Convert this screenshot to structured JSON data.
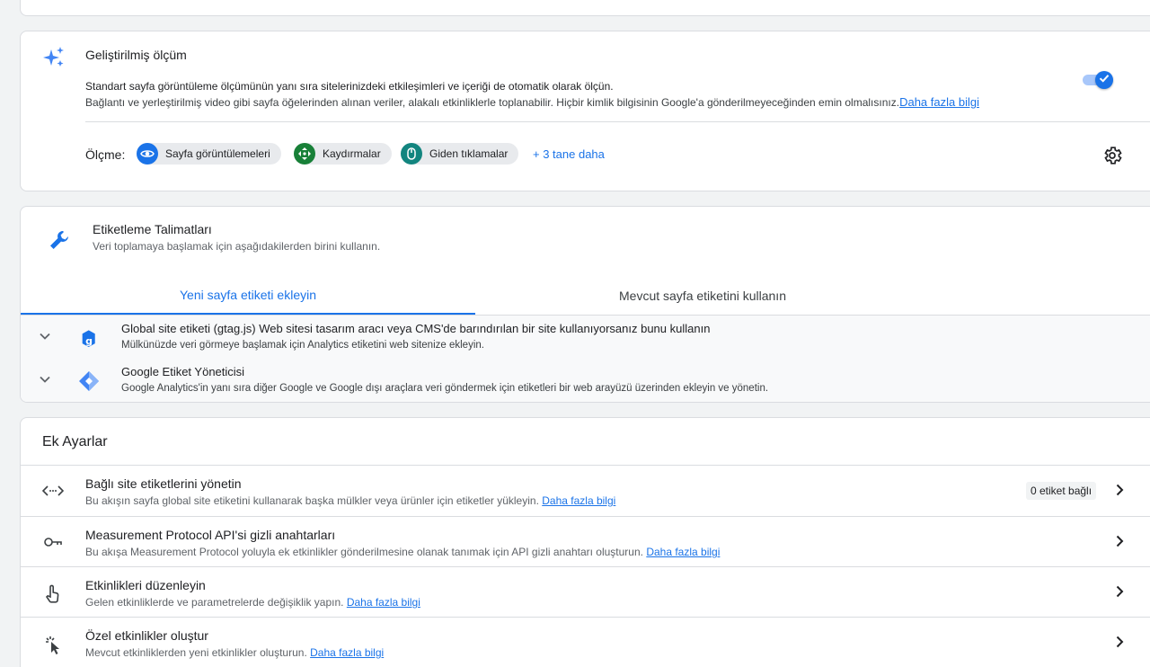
{
  "enhanced": {
    "title": "Geliştirilmiş ölçüm",
    "desc1": "Standart sayfa görüntüleme ölçümünün yanı sıra sitelerinizdeki etkileşimleri ve içeriği de otomatik olarak ölçün.",
    "desc2": "Bağlantı ve yerleştirilmiş video gibi sayfa öğelerinden alınan veriler, alakalı etkinliklerle toplanabilir. Hiçbir kimlik bilgisinin Google'a gönderilmeyeceğinden emin olmalısınız.",
    "learn_more": "Daha fazla bilgi",
    "toggle_on": true,
    "measure_label": "Ölçme:",
    "chips": [
      {
        "label": "Sayfa görüntülemeleri",
        "icon": "eye-icon",
        "color": "#1a73e8"
      },
      {
        "label": "Kaydırmalar",
        "icon": "move-icon",
        "color": "#188038"
      },
      {
        "label": "Giden tıklamalar",
        "icon": "mouse-icon",
        "color": "#12857f"
      }
    ],
    "more": "+ 3 tane daha"
  },
  "tagging": {
    "title": "Etiketleme Talimatları",
    "subtitle": "Veri toplamaya başlamak için aşağıdakilerden birini kullanın.",
    "tabs": [
      "Yeni sayfa etiketi ekleyin",
      "Mevcut sayfa etiketini kullanın"
    ],
    "rows": [
      {
        "title": "Global site etiketi (gtag.js)",
        "title_rest": " Web sitesi tasarım aracı veya CMS'de barındırılan bir site kullanıyorsanız bunu kullanın",
        "desc": "Mülkünüzde veri görmeye başlamak için Analytics etiketini web sitenize ekleyin."
      },
      {
        "title": "Google Etiket Yöneticisi",
        "title_rest": "",
        "desc": "Google Analytics'in yanı sıra diğer Google ve Google dışı araçlara veri göndermek için etiketleri bir web arayüzü üzerinden ekleyin ve yönetin."
      }
    ]
  },
  "extra": {
    "title": "Ek Ayarlar",
    "rows": [
      {
        "title": "Bağlı site etiketlerini yönetin",
        "desc": "Bu akışın sayfa global site etiketini kullanarak başka mülkler veya ürünler için etiketler yükleyin.",
        "link": "Daha fazla bilgi",
        "badge": "0 etiket bağlı",
        "icon": "code-icon"
      },
      {
        "title": "Measurement Protocol API'si gizli anahtarları",
        "desc": "Bu akışa Measurement Protocol yoluyla ek etkinlikler gönderilmesine olanak tanımak için API gizli anahtarı oluşturun.",
        "link": "Daha fazla bilgi",
        "icon": "key-icon"
      },
      {
        "title": "Etkinlikleri düzenleyin",
        "desc": "Gelen etkinliklerde ve parametrelerde değişiklik yapın.",
        "link": "Daha fazla bilgi",
        "icon": "touch-icon"
      },
      {
        "title": "Özel etkinlikler oluştur",
        "desc": "Mevcut etkinliklerden yeni etkinlikler oluşturun.",
        "link": "Daha fazla bilgi",
        "icon": "click-icon"
      }
    ]
  },
  "colors": {
    "accent": "#1a73e8",
    "border": "#dadce0",
    "text_secondary": "#5f6368"
  }
}
